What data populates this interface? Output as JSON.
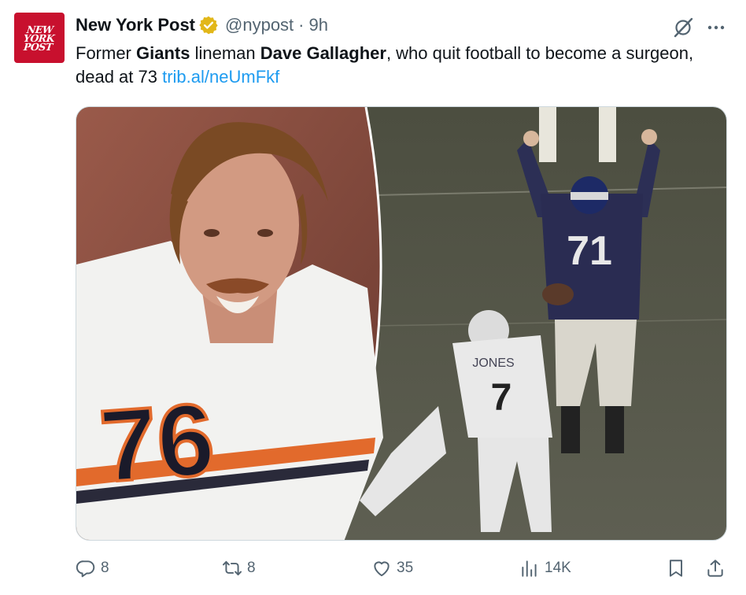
{
  "account": {
    "avatar_text_line1": "NEW",
    "avatar_text_line2": "YORK",
    "avatar_text_line3": "POST",
    "display_name": "New York Post",
    "handle": "@nypost",
    "separator": "·",
    "time": "9h",
    "verified_icon": "gold-verified-badge"
  },
  "tweet": {
    "text_1": "Former ",
    "bold_1": "Giants",
    "text_2": " lineman ",
    "bold_2": "Dave Gallagher",
    "text_3": ", who quit football to become a surgeon, dead at 73 ",
    "link": "trib.al/neUmFkf"
  },
  "media": {
    "left_jersey_number": "76",
    "right_jersey_number_1": "71",
    "right_jersey_number_2": "7",
    "right_jersey_name": "JONES"
  },
  "actions": {
    "reply_count": "8",
    "retweet_count": "8",
    "like_count": "35",
    "views_count": "14K"
  },
  "colors": {
    "accent": "#1d9bf0",
    "muted": "#536471",
    "brand_red": "#c8102e",
    "verified_gold": "#e2b719"
  }
}
